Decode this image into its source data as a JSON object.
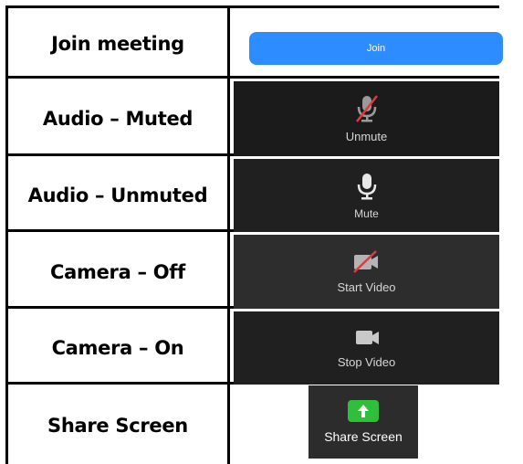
{
  "rows": [
    {
      "label": "Join meeting",
      "control": "Join"
    },
    {
      "label": "Audio – Muted",
      "control": "Unmute"
    },
    {
      "label": "Audio – Unmuted",
      "control": "Mute"
    },
    {
      "label": "Camera – Off",
      "control": "Start Video"
    },
    {
      "label": "Camera – On",
      "control": "Stop Video"
    },
    {
      "label": "Share Screen",
      "control": "Share Screen"
    }
  ],
  "icons": {
    "muted": "microphone-muted-icon",
    "unmuted": "microphone-icon",
    "camera_off": "video-camera-off-icon",
    "camera_on": "video-camera-icon",
    "share": "share-screen-icon"
  },
  "colors": {
    "join_button": "#2d8cff",
    "share_icon": "#2fbf3a",
    "mute_slash": "#e0393e",
    "toolbar_bg": "#1b1b1b"
  }
}
